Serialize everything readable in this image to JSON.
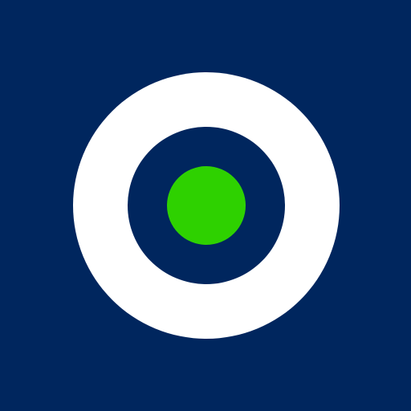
{
  "logo": {
    "icon": "target-icon",
    "colors": {
      "background": "#00265e",
      "outer_ring": "#ffffff",
      "inner_ring": "#00265e",
      "center_dot": "#2ed100"
    }
  }
}
